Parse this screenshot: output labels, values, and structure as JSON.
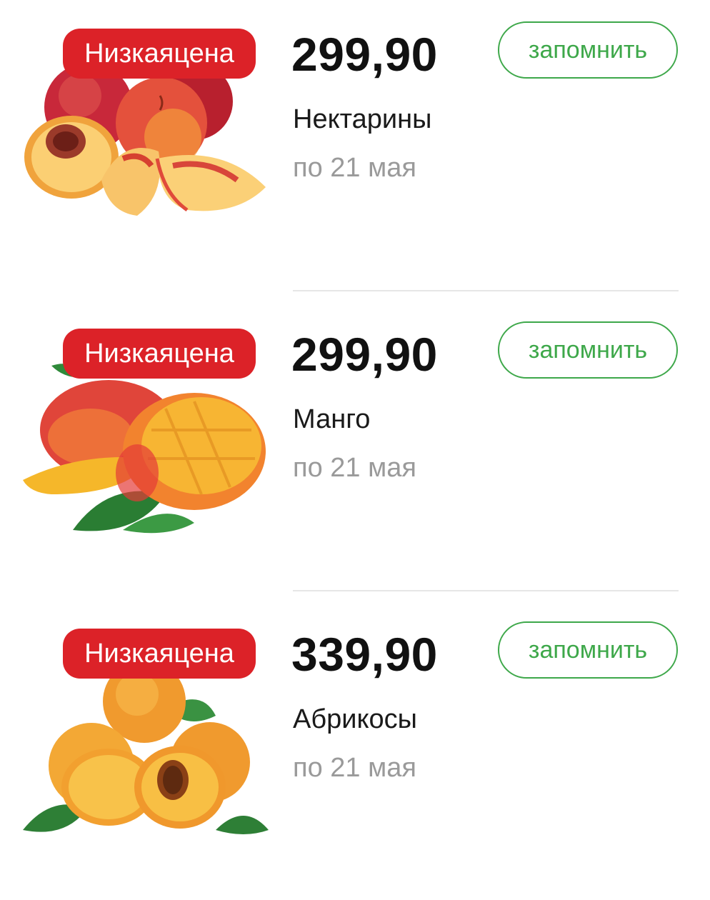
{
  "products": [
    {
      "badge": "Низкаяцена",
      "price": "299,90",
      "name": "Нектарины",
      "valid_until": "по 21 мая",
      "remember_label": "запомнить",
      "image_icon": "nectarines-image"
    },
    {
      "badge": "Низкаяцена",
      "price": "299,90",
      "name": "Манго",
      "valid_until": "по 21 мая",
      "remember_label": "запомнить",
      "image_icon": "mango-image"
    },
    {
      "badge": "Низкаяцена",
      "price": "339,90",
      "name": "Абрикосы",
      "valid_until": "по 21 мая",
      "remember_label": "запомнить",
      "image_icon": "apricots-image"
    }
  ],
  "colors": {
    "badge_bg": "#dc2228",
    "accent_green": "#3ea84a",
    "muted_text": "#9a9a9a"
  }
}
